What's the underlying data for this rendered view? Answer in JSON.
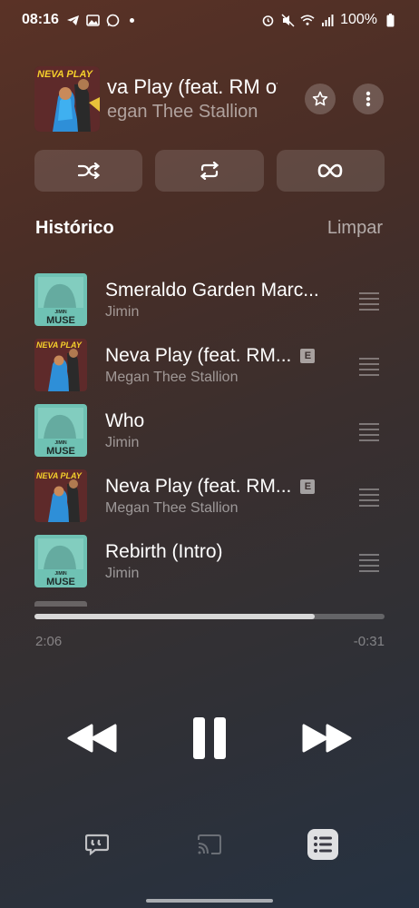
{
  "status_bar": {
    "time": "08:16",
    "battery": "100%",
    "left_icons": [
      "telegram-icon",
      "gallery-icon",
      "whatsapp-icon"
    ],
    "right_icons": [
      "alarm-icon",
      "mute-icon",
      "wifi-icon",
      "signal-icon",
      "battery-icon"
    ]
  },
  "now_playing": {
    "title": "Neva Play (feat. RM of BTS)",
    "title_visible": "va Play (feat. RM of",
    "artist": "Megan Thee Stallion",
    "artist_visible": "egan Thee Stallion",
    "art_text": "NEVA PLAY"
  },
  "modes": {
    "shuffle": "shuffle-icon",
    "repeat": "repeat-icon",
    "autoplay": "infinity-icon"
  },
  "history": {
    "title": "Histórico",
    "clear_label": "Limpar",
    "items": [
      {
        "title": "Smeraldo Garden Marc...",
        "artist": "Jimin",
        "explicit": false,
        "art": "muse"
      },
      {
        "title": "Neva Play (feat. RM...",
        "artist": "Megan Thee Stallion",
        "explicit": true,
        "art": "neva"
      },
      {
        "title": "Who",
        "artist": "Jimin",
        "explicit": false,
        "art": "muse"
      },
      {
        "title": "Neva Play (feat. RM...",
        "artist": "Megan Thee Stallion",
        "explicit": true,
        "art": "neva"
      },
      {
        "title": "Rebirth (Intro)",
        "artist": "Jimin",
        "explicit": false,
        "art": "muse"
      }
    ],
    "explicit_label": "E",
    "muse_art_text_top": "JIMIN",
    "muse_art_text_bottom": "MUSE"
  },
  "playback": {
    "elapsed": "2:06",
    "remaining": "-0:31",
    "progress_fraction": 0.8
  },
  "colors": {
    "muse_teal": "#6fc2b4",
    "neva_blue": "#2e8fd8",
    "neva_bg": "#1c1a2a"
  }
}
